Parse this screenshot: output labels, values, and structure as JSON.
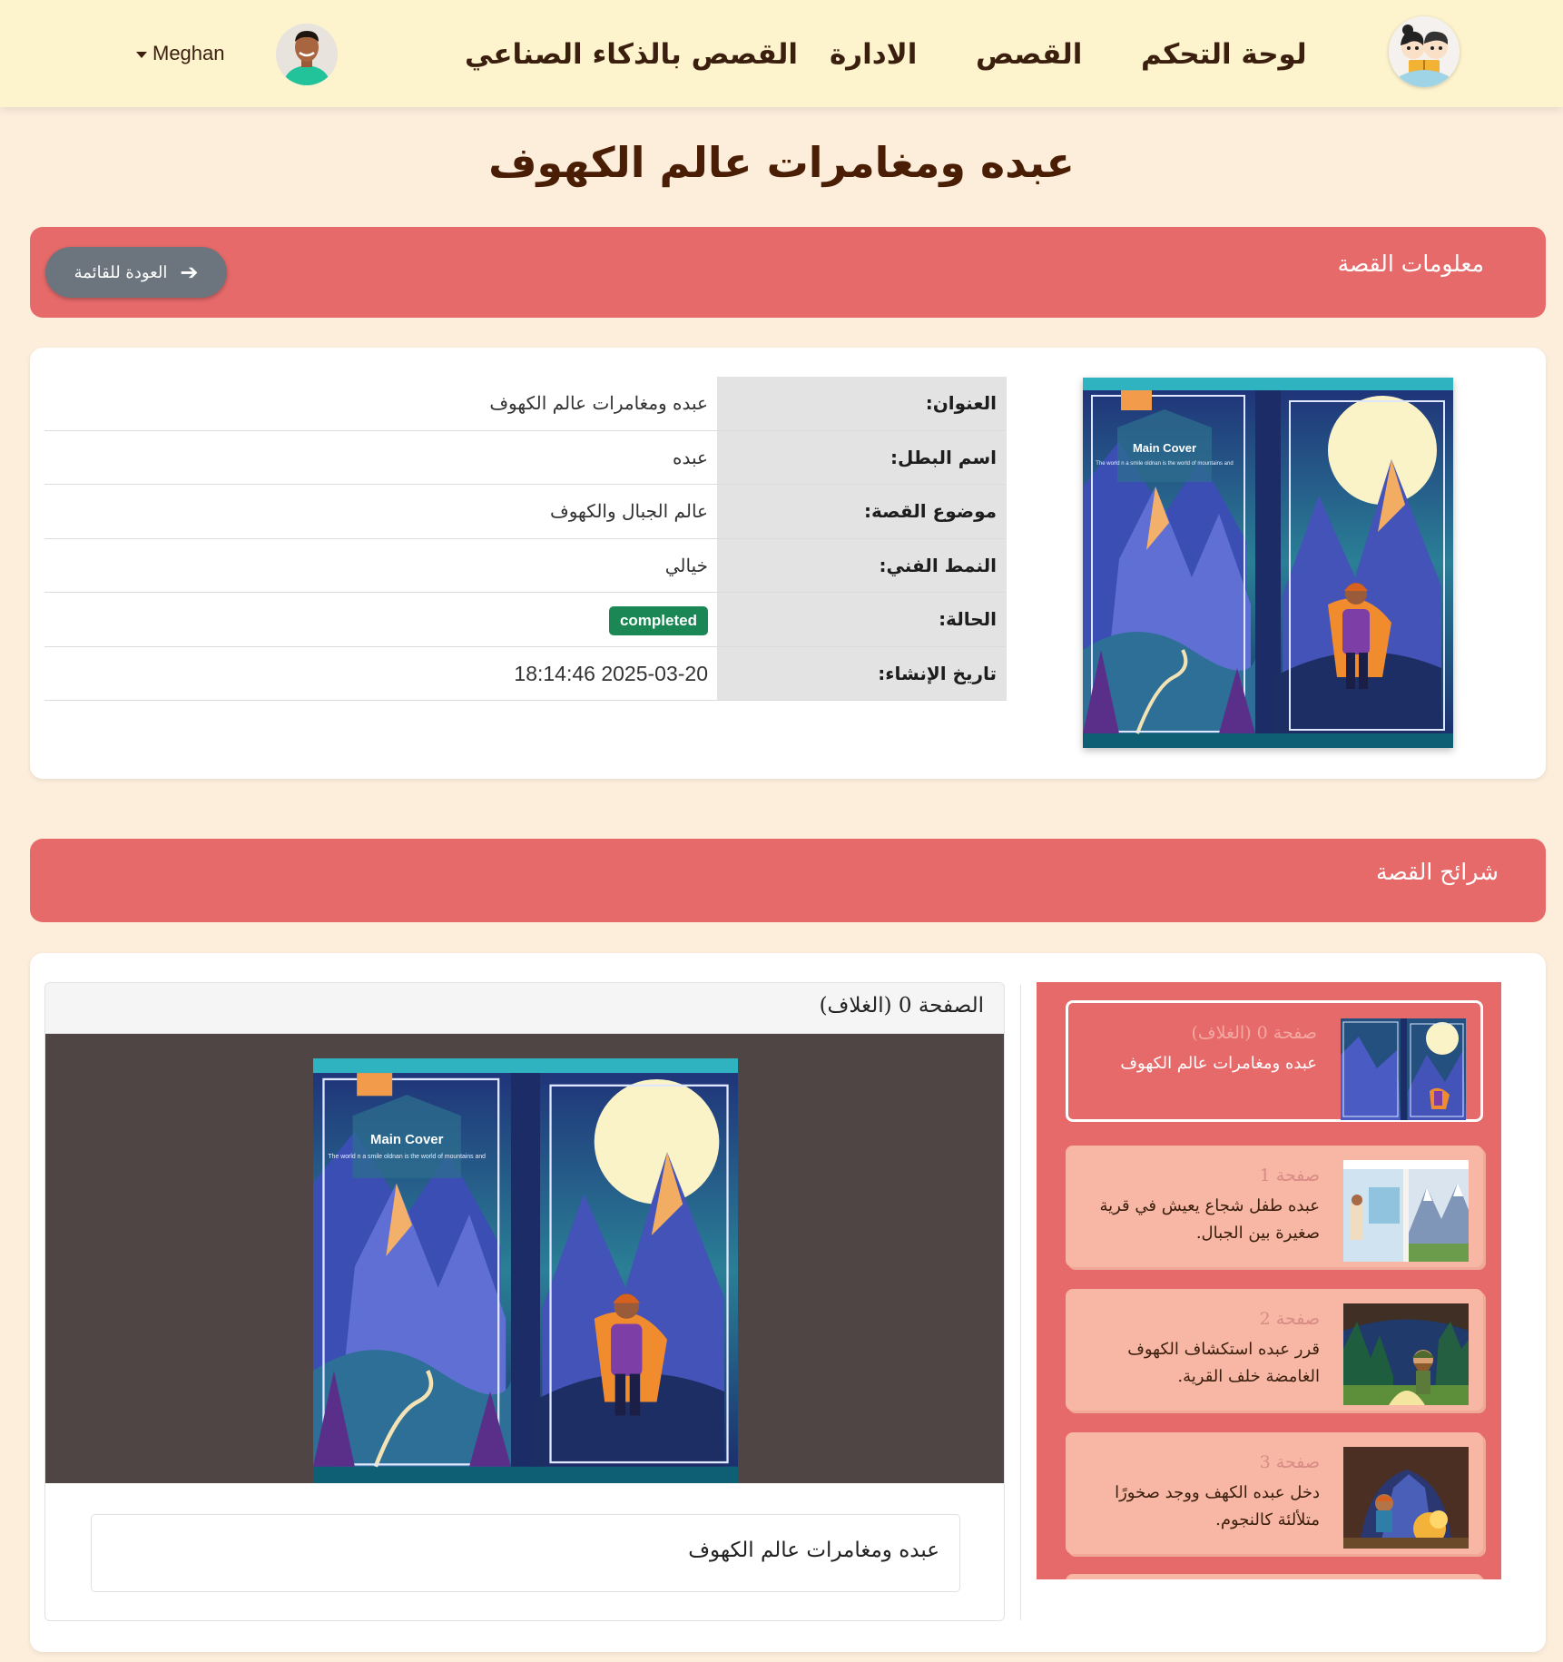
{
  "nav": {
    "links": [
      "لوحة التحكم",
      "القصص",
      "الادارة",
      "القصص بالذكاء الصناعي"
    ],
    "user_name": "Meghan"
  },
  "page_title": "عبده ومغامرات عالم الكهوف",
  "info_section": {
    "header": "معلومات القصة",
    "back_button": "العودة للقائمة",
    "rows": [
      {
        "key": "العنوان:",
        "value": "عبده ومغامرات عالم الكهوف"
      },
      {
        "key": "اسم البطل:",
        "value": "عبده"
      },
      {
        "key": "موضوع القصة:",
        "value": "عالم الجبال والكهوف"
      },
      {
        "key": "النمط الفني:",
        "value": "خيالي"
      },
      {
        "key": "الحالة:",
        "value": "completed"
      },
      {
        "key": "تاريخ الإنشاء:",
        "value": "2025-03-20 18:14:46"
      }
    ],
    "cover_text": {
      "title": "Main Cover",
      "subtitle": "The world n a smile oldnan is the world of mountains and"
    }
  },
  "slides_section": {
    "header": "شرائح القصة",
    "viewer_title": "الصفحة 0 (الغلاف)",
    "viewer_caption": "عبده ومغامرات عالم الكهوف",
    "slides": [
      {
        "title": "صفحة 0 (الغلاف)",
        "text": "عبده ومغامرات عالم الكهوف"
      },
      {
        "title": "صفحة 1",
        "text": "عبده طفل شجاع يعيش في قرية صغيرة بين الجبال."
      },
      {
        "title": "صفحة 2",
        "text": "قرر عبده استكشاف الكهوف الغامضة خلف القرية."
      },
      {
        "title": "صفحة 3",
        "text": "دخل عبده الكهف ووجد صخورًا متلألئة كالنجوم."
      }
    ]
  },
  "colors": {
    "navbar_bg": "#fdf3cd",
    "page_bg": "#fdeedc",
    "section_header": "#e76a6a",
    "badge_success": "#1a8754",
    "back_button": "#6c757d"
  }
}
